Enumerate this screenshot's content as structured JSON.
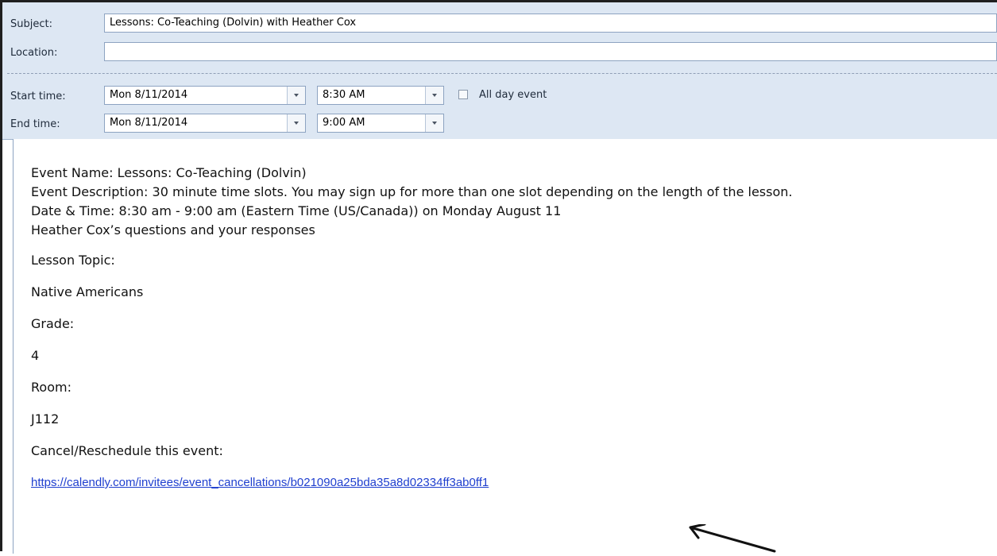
{
  "form": {
    "subject_label": "Subject:",
    "subject_value": "Lessons: Co-Teaching (Dolvin) with Heather Cox",
    "location_label": "Location:",
    "location_value": "",
    "start_label": "Start time:",
    "start_date": "Mon 8/11/2014",
    "start_time": "8:30 AM",
    "allday_label": "All day event",
    "allday_checked": false,
    "end_label": "End time:",
    "end_date": "Mon 8/11/2014",
    "end_time": "9:00 AM"
  },
  "body": {
    "event_name": "Event Name: Lessons: Co-Teaching (Dolvin)",
    "event_description": "Event Description: 30 minute time slots.  You may sign up for more than one slot depending on the length of the lesson.",
    "date_time": "Date & Time:  8:30 am -  9:00 am (Eastern Time (US/Canada)) on Monday August 11",
    "questions_heading": "Heather Cox’s questions and your responses",
    "q1_label": "Lesson Topic:",
    "q1_answer": "Native Americans",
    "q2_label": "Grade:",
    "q2_answer": "4",
    "q3_label": "Room:",
    "q3_answer": "J112",
    "cancel_label": "Cancel/Reschedule this event:",
    "cancel_link": "https://calendly.com/invitees/event_cancellations/b021090a25bda35a8d02334ff3ab0ff1"
  },
  "icons": {
    "dropdown": "chevron-down-icon",
    "arrow": "arrow-pointer-icon"
  },
  "colors": {
    "header_bg": "#dde7f3",
    "link": "#1f3fcf"
  }
}
